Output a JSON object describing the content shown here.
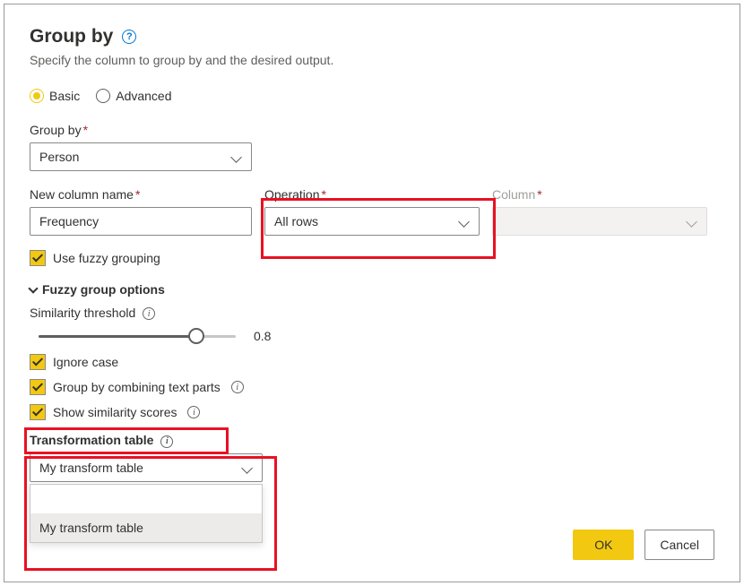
{
  "title": "Group by",
  "subtitle": "Specify the column to group by and the desired output.",
  "mode": {
    "basic": "Basic",
    "advanced": "Advanced"
  },
  "groupby": {
    "label": "Group by",
    "value": "Person"
  },
  "newColumn": {
    "label": "New column name",
    "value": "Frequency"
  },
  "operation": {
    "label": "Operation",
    "value": "All rows"
  },
  "column": {
    "label": "Column",
    "value": ""
  },
  "fuzzy": {
    "useFuzzy": "Use fuzzy grouping",
    "optionsHeader": "Fuzzy group options",
    "thresholdLabel": "Similarity threshold",
    "thresholdValue": "0.8",
    "ignoreCase": "Ignore case",
    "combineText": "Group by combining text parts",
    "showScores": "Show similarity scores",
    "transformLabel": "Transformation table",
    "transformValue": "My transform table",
    "transformOptions": [
      "My transform table"
    ]
  },
  "buttons": {
    "ok": "OK",
    "cancel": "Cancel"
  }
}
